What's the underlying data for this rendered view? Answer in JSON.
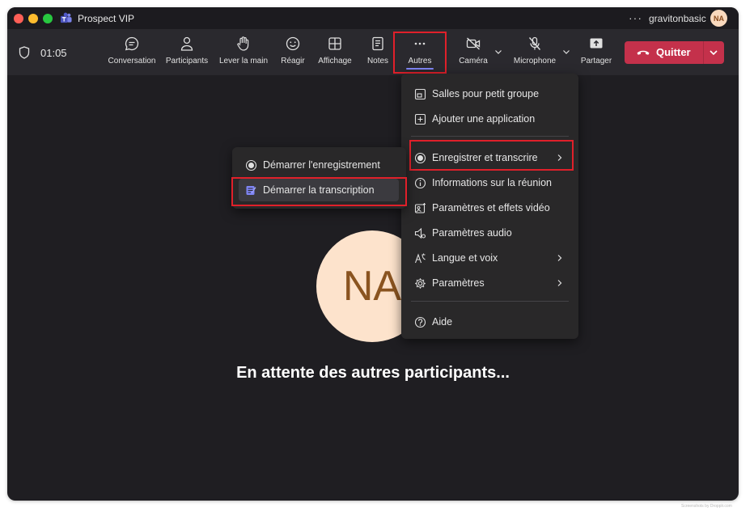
{
  "window": {
    "title": "Prospect VIP",
    "account": "gravitonbasic",
    "avatar_initials": "NA",
    "more_label": "···"
  },
  "toolbar": {
    "timer": "01:05",
    "buttons": {
      "conversation": "Conversation",
      "participants": "Participants",
      "raise_hand": "Lever la main",
      "react": "Réagir",
      "view": "Affichage",
      "notes": "Notes",
      "more": "Autres",
      "camera": "Caméra",
      "microphone": "Microphone",
      "share": "Partager"
    },
    "leave": "Quitter"
  },
  "stage": {
    "avatar_initials": "NA",
    "waiting_text": "En attente des autres participants..."
  },
  "more_menu": {
    "items": [
      {
        "label": "Salles pour petit groupe",
        "icon": "breakout-rooms-icon"
      },
      {
        "label": "Ajouter une application",
        "icon": "add-app-icon"
      },
      {
        "label": "Enregistrer et transcrire",
        "icon": "record-icon"
      },
      {
        "label": "Informations sur la réunion",
        "icon": "info-icon"
      },
      {
        "label": "Paramètres et effets vidéo",
        "icon": "video-effects-icon"
      },
      {
        "label": "Paramètres audio",
        "icon": "speaker-settings-icon"
      },
      {
        "label": "Langue et voix",
        "icon": "language-icon"
      },
      {
        "label": "Paramètres",
        "icon": "gear-icon"
      },
      {
        "label": "Aide",
        "icon": "help-icon"
      }
    ]
  },
  "record_submenu": {
    "items": [
      {
        "label": "Démarrer l'enregistrement",
        "icon": "record-icon"
      },
      {
        "label": "Démarrer la transcription",
        "icon": "transcript-icon"
      }
    ]
  },
  "footer": {
    "note": "Screenshots by Dropplr.com"
  },
  "colors": {
    "accent": "#7f85f5",
    "leave_button": "#c4314b",
    "highlight_box": "#e0202a",
    "background": "#1f1e22"
  }
}
